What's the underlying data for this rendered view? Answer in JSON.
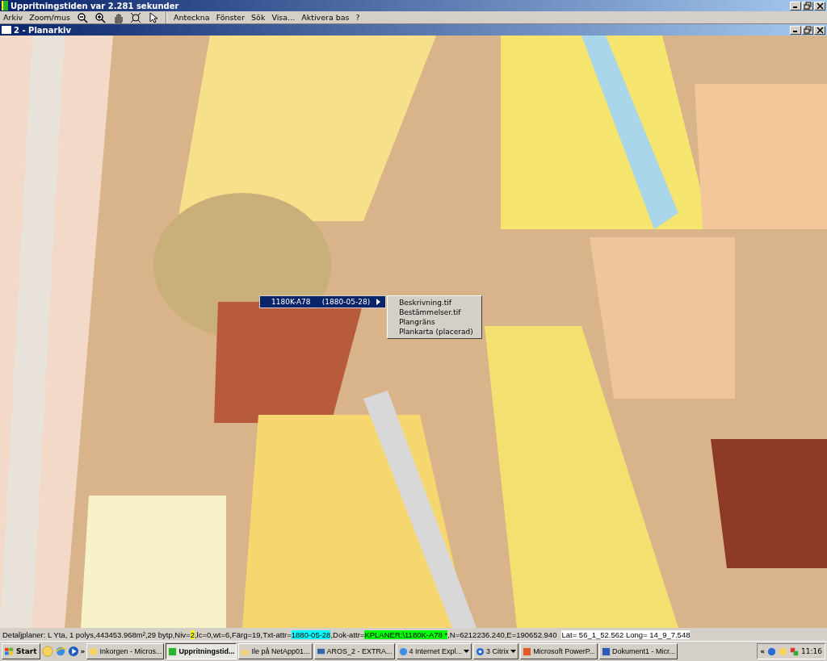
{
  "window": {
    "title": "Uppritningstiden var 2.281 sekunder"
  },
  "menu": [
    {
      "kind": "text",
      "label": "Arkiv"
    },
    {
      "kind": "text",
      "label": "Zoom/mus"
    },
    {
      "kind": "zoomout"
    },
    {
      "kind": "zoomin"
    },
    {
      "kind": "pan"
    },
    {
      "kind": "extent"
    },
    {
      "kind": "pointer"
    },
    {
      "kind": "separator"
    },
    {
      "kind": "text",
      "label": "Anteckna"
    },
    {
      "kind": "text",
      "label": "Fönster"
    },
    {
      "kind": "text",
      "label": "Sök"
    },
    {
      "kind": "text",
      "label": "Visa..."
    },
    {
      "kind": "text",
      "label": "Aktivera bas"
    },
    {
      "kind": "text",
      "label": "?"
    }
  ],
  "child_window": {
    "title": "2 - Planarkiv"
  },
  "context_menu": {
    "item": {
      "label": "1180K-A78     (1880-05-28)",
      "selected": true
    },
    "submenu": [
      {
        "label": "Beskrivning.tif",
        "selected": false
      },
      {
        "label": "Bestämmelser.tif",
        "selected": false
      },
      {
        "label": "Plangräns",
        "selected": false
      },
      {
        "label": "Plankarta (placerad)",
        "selected": false
      }
    ]
  },
  "status_bar": {
    "segments": [
      {
        "text": "Detaljplaner: L Yta, 1 polys,443453.968m²,29 bytp,Niv="
      },
      {
        "text": "2",
        "color": "#ffff00"
      },
      {
        "text": ",lc=0,wt=6,Färg=19,Txt-attr="
      },
      {
        "text": "1880-05-28",
        "color": "#00ffff"
      },
      {
        "text": ",Dok-attr="
      },
      {
        "text": "KPLANER:\\1180K-A78 *",
        "color": "#00ff00"
      },
      {
        "text": ",N=6212236.240,E=190652.940"
      },
      {
        "text": "Lat= 56_1_52.562  Long= 14_9_7.548",
        "color": "#ffffff"
      }
    ]
  },
  "taskbar": {
    "start": "Start",
    "overflow": "»",
    "buttons": [
      {
        "label": "Inkorgen - Micros...",
        "selected": false,
        "group": false
      },
      {
        "label": "Uppritningstid...",
        "selected": true,
        "group": false
      },
      {
        "label": "Ile på NetApp01...",
        "selected": false,
        "group": false
      },
      {
        "label": "AROS_2 - EXTRA...",
        "selected": false,
        "group": false
      },
      {
        "label": "4 Internet Expl...",
        "selected": false,
        "group": true
      },
      {
        "label": "3 Citrix",
        "selected": false,
        "group": true
      },
      {
        "label": "Microsoft PowerP...",
        "selected": false,
        "group": false
      },
      {
        "label": "Dokument1 - Micr...",
        "selected": false,
        "group": false
      }
    ],
    "tray_expand": "«",
    "clock": "11:16"
  }
}
